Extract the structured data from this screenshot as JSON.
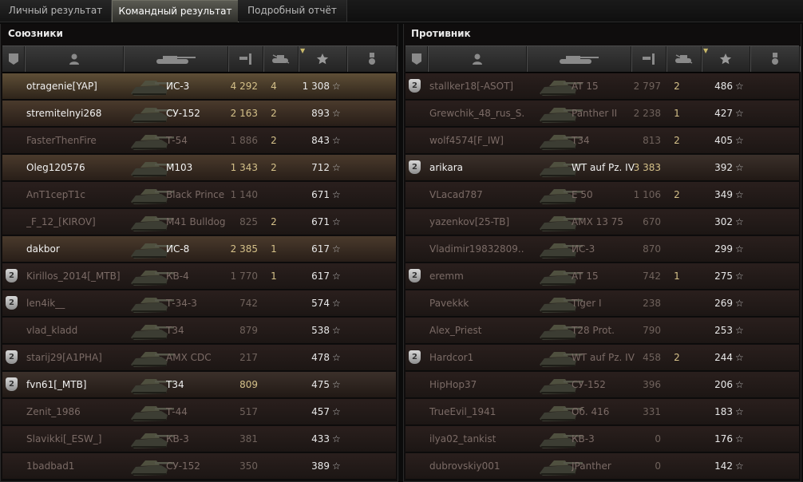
{
  "tabs": [
    {
      "label": "Личный результат"
    },
    {
      "label": "Командный результат"
    },
    {
      "label": "Подробный отчёт"
    }
  ],
  "active_tab": 1,
  "allies": {
    "title": "Союзники",
    "header_icons": [
      "rank-icon",
      "player-icon",
      "tank-icon",
      "damage-icon",
      "kills-icon",
      "star-icon",
      "medal-icon"
    ],
    "rows": [
      {
        "name": "otragenie[YAP]",
        "vehicle": "ИС-3",
        "damage": "4 292",
        "kills": "4",
        "xp": "1 308",
        "bright": true,
        "style": "me",
        "badge": false
      },
      {
        "name": "stremitelnyi268",
        "vehicle": "СУ-152",
        "damage": "2 163",
        "kills": "2",
        "xp": "893",
        "bright": true,
        "style": "hl",
        "badge": false
      },
      {
        "name": "FasterThenFire",
        "vehicle": "Т-54",
        "damage": "1 886",
        "kills": "2",
        "xp": "843",
        "bright": false,
        "style": "",
        "badge": false
      },
      {
        "name": "Oleg120576",
        "vehicle": "M103",
        "damage": "1 343",
        "kills": "2",
        "xp": "712",
        "bright": true,
        "style": "hl",
        "badge": false
      },
      {
        "name": "AnT1cepT1c",
        "vehicle": "Black Prince",
        "damage": "1 140",
        "kills": "",
        "xp": "671",
        "bright": false,
        "style": "",
        "badge": false
      },
      {
        "name": "_F_12_[KIROV]",
        "vehicle": "M41 Bulldog",
        "damage": "825",
        "kills": "2",
        "xp": "671",
        "bright": false,
        "style": "",
        "badge": false
      },
      {
        "name": "dakbor",
        "vehicle": "ИС-8",
        "damage": "2 385",
        "kills": "1",
        "xp": "617",
        "bright": true,
        "style": "hl",
        "badge": false
      },
      {
        "name": "Kirillos_2014[_MTB]",
        "vehicle": "КВ-4",
        "damage": "1 770",
        "kills": "1",
        "xp": "617",
        "bright": false,
        "style": "",
        "badge": true
      },
      {
        "name": "len4ik__",
        "vehicle": "Т-34-3",
        "damage": "742",
        "kills": "",
        "xp": "574",
        "bright": false,
        "style": "",
        "badge": true
      },
      {
        "name": "vlad_kladd",
        "vehicle": "T34",
        "damage": "879",
        "kills": "",
        "xp": "538",
        "bright": false,
        "style": "",
        "badge": false
      },
      {
        "name": "starij29[A1PHA]",
        "vehicle": "AMX CDC",
        "damage": "217",
        "kills": "",
        "xp": "478",
        "bright": false,
        "style": "",
        "badge": true
      },
      {
        "name": "fvn61[_MTB]",
        "vehicle": "T34",
        "damage": "809",
        "kills": "",
        "xp": "475",
        "bright": true,
        "style": "sq",
        "badge": true
      },
      {
        "name": "Zenit_1986",
        "vehicle": "Т-44",
        "damage": "517",
        "kills": "",
        "xp": "457",
        "bright": false,
        "style": "",
        "badge": false
      },
      {
        "name": "Slavikki[_ESW_]",
        "vehicle": "КВ-3",
        "damage": "381",
        "kills": "",
        "xp": "433",
        "bright": false,
        "style": "",
        "badge": false
      },
      {
        "name": "1badbad1",
        "vehicle": "СУ-152",
        "damage": "350",
        "kills": "",
        "xp": "389",
        "bright": false,
        "style": "",
        "badge": false
      }
    ]
  },
  "enemies": {
    "title": "Противник",
    "rows": [
      {
        "name": "stallker18[-ASOT]",
        "vehicle": "AT 15",
        "damage": "2 797",
        "kills": "2",
        "xp": "486",
        "bright": false,
        "style": "",
        "badge": true
      },
      {
        "name": "Grewchik_48_rus_S..",
        "vehicle": "Panther II",
        "damage": "2 238",
        "kills": "1",
        "xp": "427",
        "bright": false,
        "style": "",
        "badge": false
      },
      {
        "name": "wolf4574[F_IW]",
        "vehicle": "T34",
        "damage": "813",
        "kills": "2",
        "xp": "405",
        "bright": false,
        "style": "",
        "badge": false
      },
      {
        "name": "arikara",
        "vehicle": "WT auf Pz. IV",
        "damage": "3 383",
        "kills": "",
        "xp": "392",
        "bright": true,
        "style": "sq",
        "badge": true
      },
      {
        "name": "VLacad787",
        "vehicle": "E 50",
        "damage": "1 106",
        "kills": "2",
        "xp": "349",
        "bright": false,
        "style": "",
        "badge": false
      },
      {
        "name": "yazenkov[25-TB]",
        "vehicle": "AMX 13 75",
        "damage": "670",
        "kills": "",
        "xp": "302",
        "bright": false,
        "style": "",
        "badge": false
      },
      {
        "name": "Vladimir19832809..",
        "vehicle": "ИС-3",
        "damage": "870",
        "kills": "",
        "xp": "299",
        "bright": false,
        "style": "",
        "badge": false
      },
      {
        "name": "eremm",
        "vehicle": "AT 15",
        "damage": "742",
        "kills": "1",
        "xp": "275",
        "bright": false,
        "style": "",
        "badge": true
      },
      {
        "name": "Pavekkk",
        "vehicle": "Tiger I",
        "damage": "238",
        "kills": "",
        "xp": "269",
        "bright": false,
        "style": "",
        "badge": false
      },
      {
        "name": "Alex_Priest",
        "vehicle": "T28 Prot.",
        "damage": "790",
        "kills": "",
        "xp": "253",
        "bright": false,
        "style": "",
        "badge": false
      },
      {
        "name": "Hardcor1",
        "vehicle": "WT auf Pz. IV",
        "damage": "458",
        "kills": "2",
        "xp": "244",
        "bright": false,
        "style": "",
        "badge": true
      },
      {
        "name": "HipHop37",
        "vehicle": "СУ-152",
        "damage": "396",
        "kills": "",
        "xp": "206",
        "bright": false,
        "style": "",
        "badge": false
      },
      {
        "name": "TrueEvil_1941",
        "vehicle": "Об. 416",
        "damage": "331",
        "kills": "",
        "xp": "183",
        "bright": false,
        "style": "",
        "badge": false
      },
      {
        "name": "ilya02_tankist",
        "vehicle": "КВ-3",
        "damage": "0",
        "kills": "",
        "xp": "176",
        "bright": false,
        "style": "",
        "badge": false
      },
      {
        "name": "dubrovskiy001",
        "vehicle": "JPanther",
        "damage": "0",
        "kills": "",
        "xp": "142",
        "bright": false,
        "style": "",
        "badge": false
      }
    ]
  },
  "colors": {
    "gold": "#d4c089",
    "bright": "#f2f2f2",
    "dim": "#7b6b66"
  }
}
